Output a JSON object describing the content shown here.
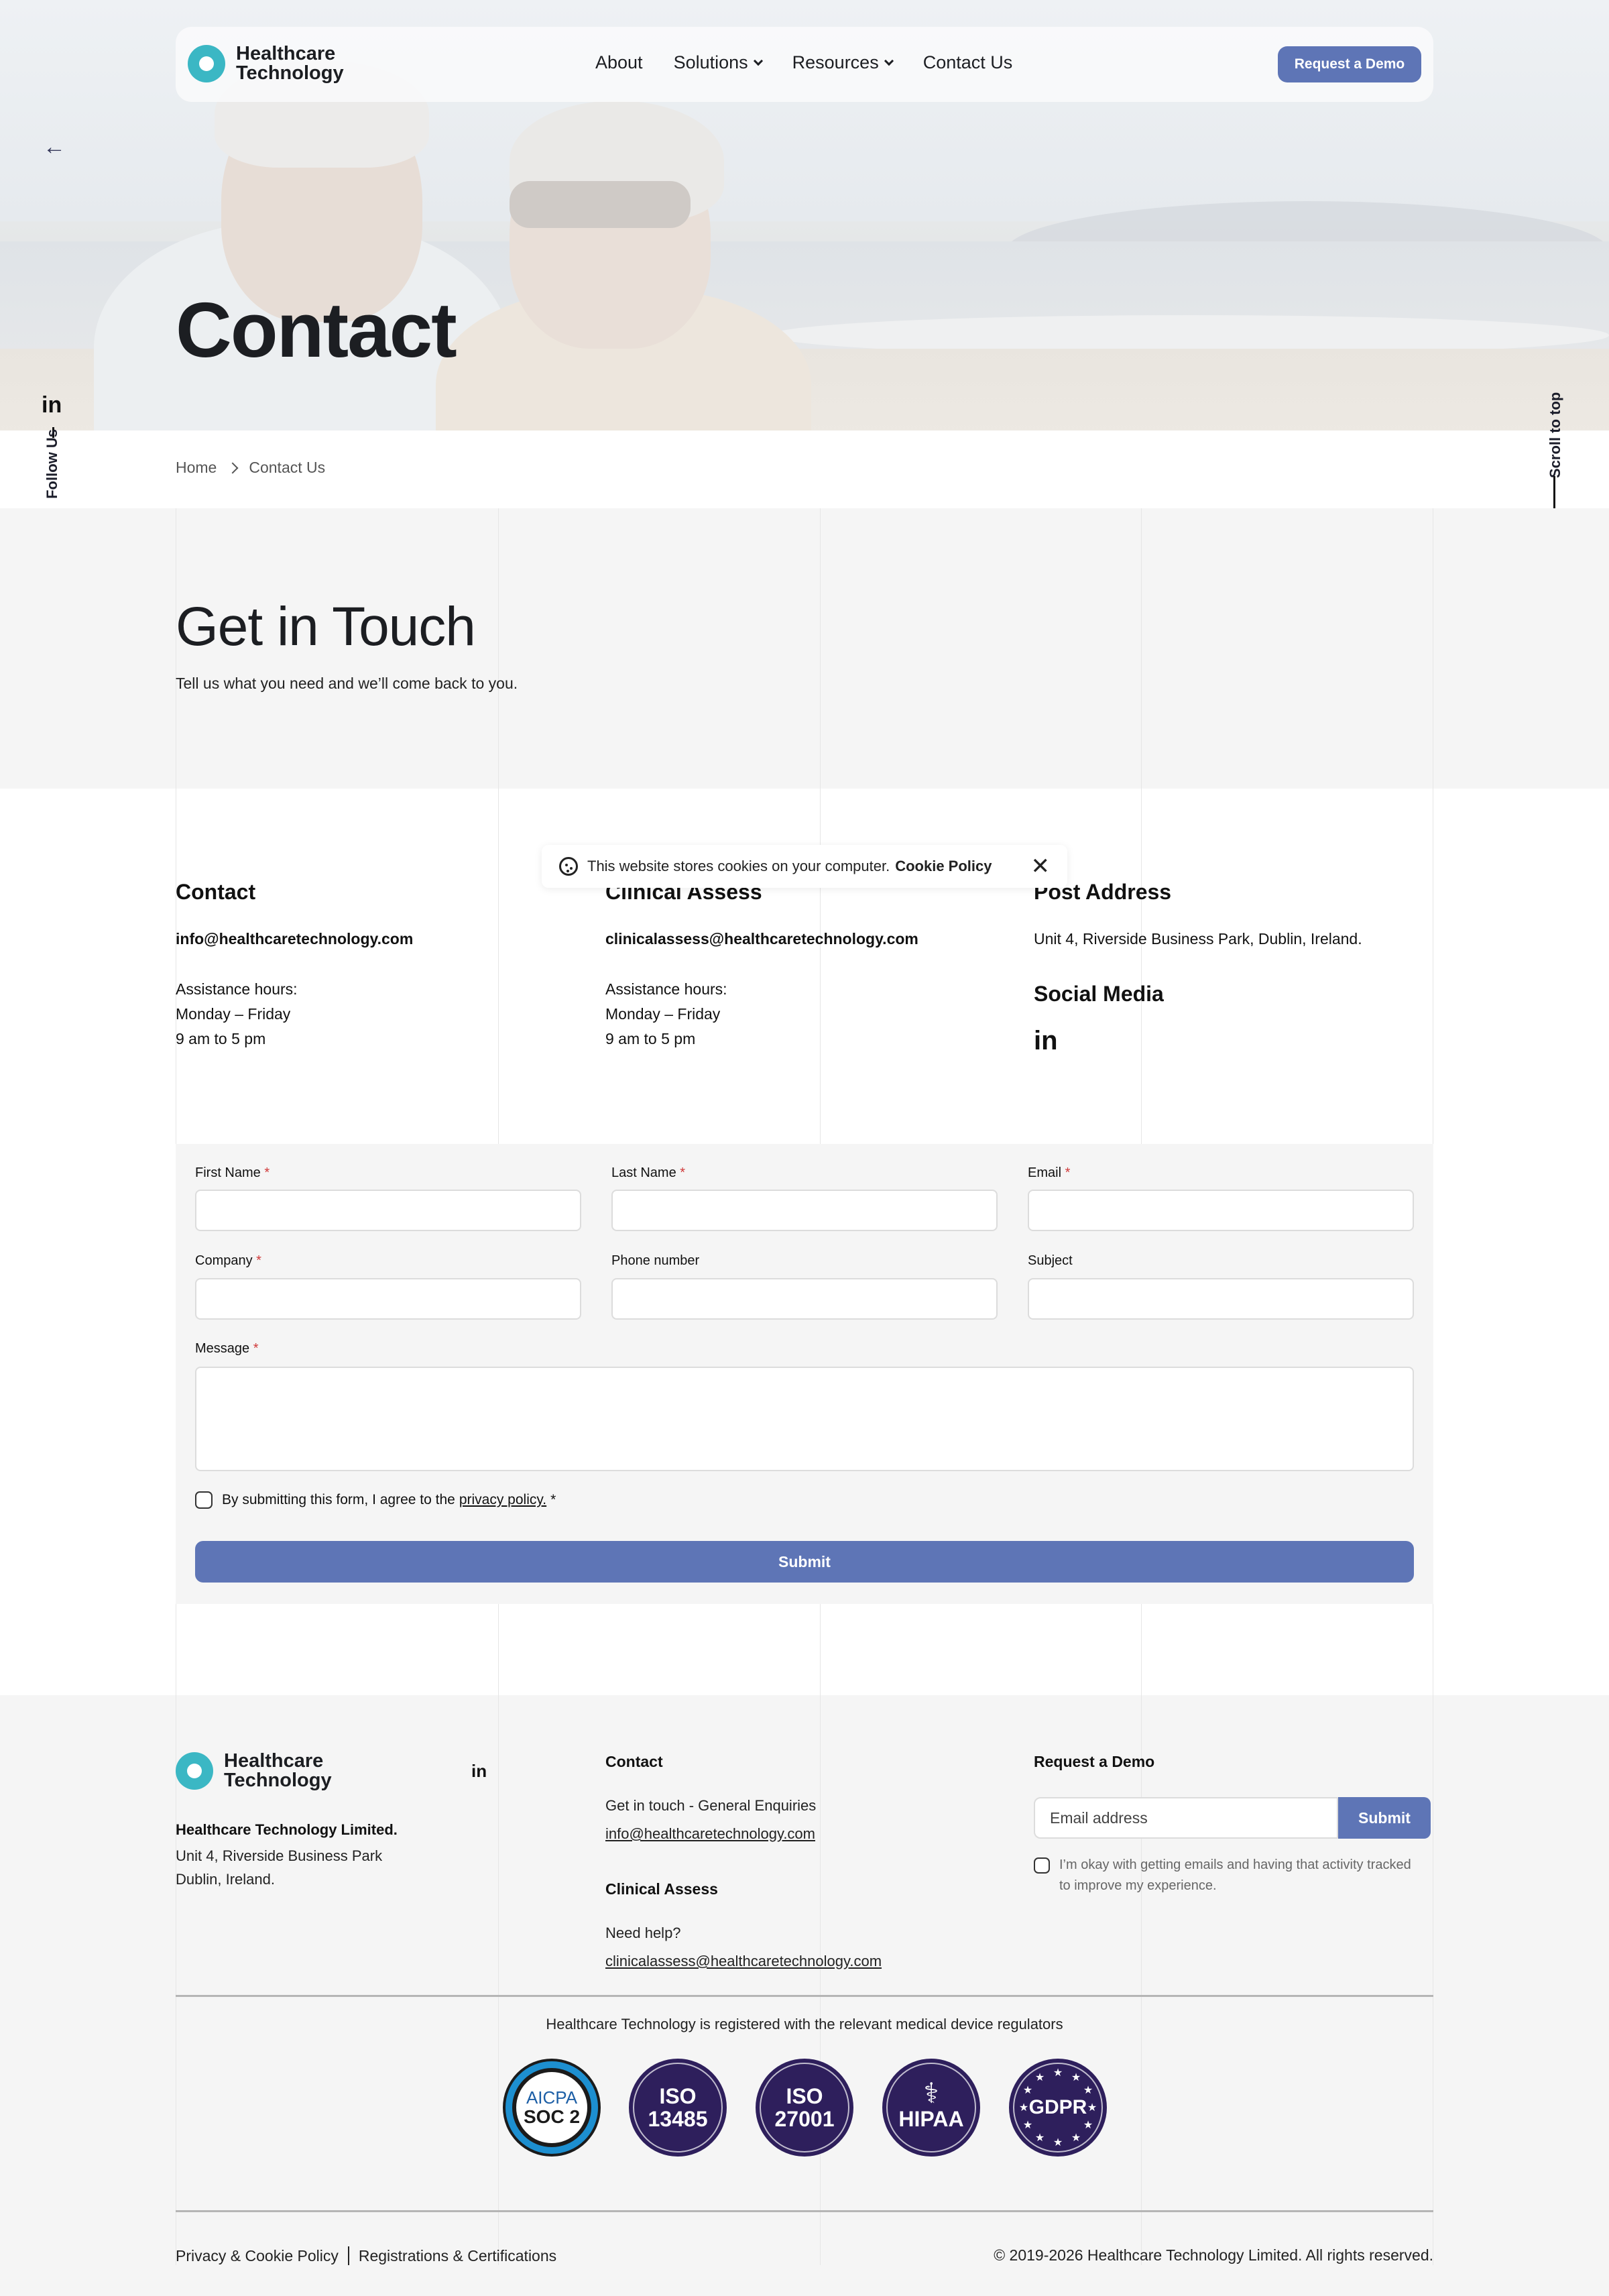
{
  "brand": {
    "line1": "Healthcare",
    "line2": "Technology",
    "accent": "#3bb7c4",
    "button_color": "#5e75b6"
  },
  "nav": {
    "items": [
      "About",
      "Solutions",
      "Resources",
      "Contact Us"
    ],
    "cta": "Request a Demo"
  },
  "hero": {
    "title": "Contact"
  },
  "side": {
    "follow": "Follow Us",
    "linkedin": "in",
    "scroll": "Scroll to top"
  },
  "breadcrumb": {
    "home": "Home",
    "current": "Contact Us"
  },
  "intro": {
    "title": "Get in Touch",
    "subtitle": "Tell us what you need and we’ll come back to you."
  },
  "cookie": {
    "text": "This website stores cookies on your computer.",
    "link": "Cookie Policy",
    "close": "✕"
  },
  "contact": {
    "heading": "Contact",
    "email": "info@healthcaretechnology.com",
    "hours_label": "Assistance hours:",
    "days": "Monday – Friday",
    "time": "9 am to 5 pm"
  },
  "clinical": {
    "heading": "Clinical Assess",
    "email": "clinicalassess@healthcaretechnology.com",
    "hours_label": "Assistance hours:",
    "days": "Monday – Friday",
    "time": "9 am to 5 pm"
  },
  "post": {
    "heading": "Post Address",
    "address": "Unit 4, Riverside Business Park, Dublin, Ireland."
  },
  "social": {
    "heading": "Social Media",
    "icon": "in"
  },
  "form": {
    "first_name": "First Name",
    "last_name": "Last Name",
    "email": "Email",
    "company": "Company",
    "phone": "Phone number",
    "subject": "Subject",
    "message": "Message",
    "required_mark": "*",
    "consent_prefix": "By submitting this form, I agree to the",
    "consent_link": "privacy policy.",
    "submit": "Submit"
  },
  "footer": {
    "company": "Healthcare Technology Limited.",
    "address_line1": "Unit 4, Riverside Business Park",
    "address_line2": "Dublin, Ireland.",
    "linkedin": "in",
    "contact_heading": "Contact",
    "contact_text": "Get in touch - General Enquiries",
    "contact_email": "info@healthcaretechnology.com",
    "clinical_heading": "Clinical Assess",
    "clinical_text": "Need help?",
    "clinical_email": "clinicalassess@healthcaretechnology.com",
    "demo_heading": "Request a Demo",
    "email_placeholder": "Email address",
    "demo_submit": "Submit",
    "consent": "I’m okay with getting emails and having that activity tracked to improve my experience.",
    "regulators": "Healthcare Technology is registered with the relevant medical device regulators",
    "badges": [
      {
        "l1": "AICPA",
        "l2": "SOC 2"
      },
      {
        "l1": "ISO",
        "l2": "13485"
      },
      {
        "l1": "ISO",
        "l2": "27001"
      },
      {
        "l1": "HIPAA"
      },
      {
        "l1": "GDPR"
      }
    ],
    "privacy": "Privacy & Cookie Policy",
    "registrations": "Registrations & Certifications",
    "copyright": "© 2019-2026  Healthcare Technology Limited.  All rights reserved."
  }
}
